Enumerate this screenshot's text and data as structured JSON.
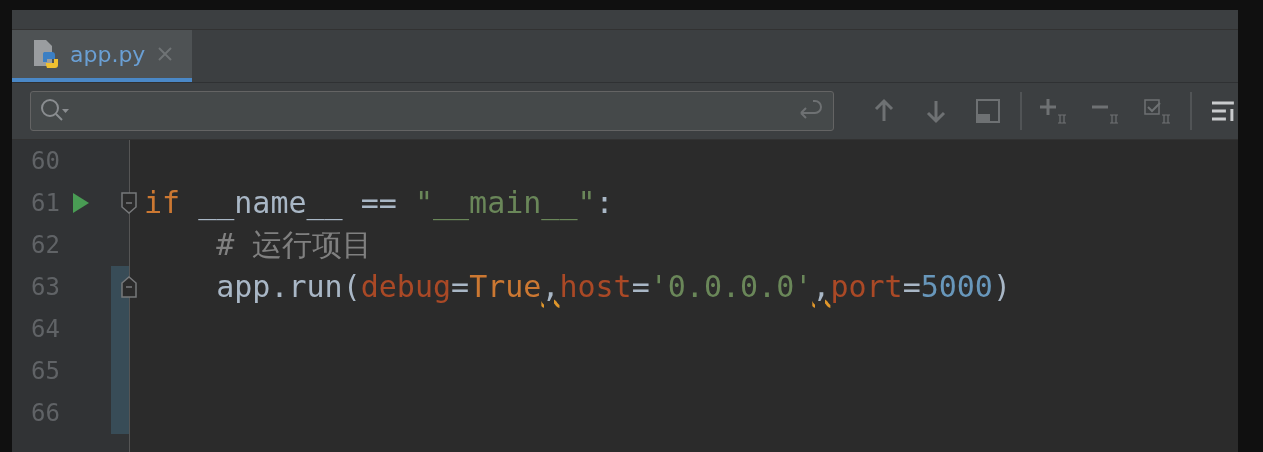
{
  "tabs": [
    {
      "label": "app.py",
      "selected": true
    }
  ],
  "editor": {
    "lines": [
      {
        "number": "60",
        "run": false,
        "fold_start": false,
        "fold_end": false,
        "changed": false
      },
      {
        "number": "61",
        "run": true,
        "fold_start": true,
        "fold_end": false,
        "changed": false,
        "tokens": [
          {
            "text": "if",
            "kind": "keyword"
          },
          {
            "text": " __name__ == ",
            "kind": "plain"
          },
          {
            "text": "\"__main__\"",
            "kind": "string"
          },
          {
            "text": ":",
            "kind": "plain"
          }
        ]
      },
      {
        "number": "62",
        "run": false,
        "fold_start": false,
        "fold_end": false,
        "changed": false,
        "tokens": [
          {
            "text": "    # 运行项目",
            "kind": "comment"
          }
        ]
      },
      {
        "number": "63",
        "run": false,
        "fold_start": false,
        "fold_end": true,
        "changed": true,
        "tokens": [
          {
            "text": "    app.run(",
            "kind": "plain"
          },
          {
            "text": "debug",
            "kind": "param"
          },
          {
            "text": "=",
            "kind": "plain"
          },
          {
            "text": "True",
            "kind": "keyword"
          },
          {
            "text": ",",
            "kind": "plain",
            "warning": true
          },
          {
            "text": "host",
            "kind": "param"
          },
          {
            "text": "=",
            "kind": "plain"
          },
          {
            "text": "'0.0.0.0'",
            "kind": "string"
          },
          {
            "text": ",",
            "kind": "plain",
            "warning": true
          },
          {
            "text": "port",
            "kind": "param"
          },
          {
            "text": "=",
            "kind": "plain"
          },
          {
            "text": "5000",
            "kind": "number"
          },
          {
            "text": ")",
            "kind": "plain"
          }
        ]
      },
      {
        "number": "64",
        "run": false,
        "fold_start": false,
        "fold_end": false,
        "changed": true
      },
      {
        "number": "65",
        "run": false,
        "fold_start": false,
        "fold_end": false,
        "changed": true
      },
      {
        "number": "66",
        "run": false,
        "fold_start": false,
        "fold_end": false,
        "changed": true
      }
    ]
  }
}
